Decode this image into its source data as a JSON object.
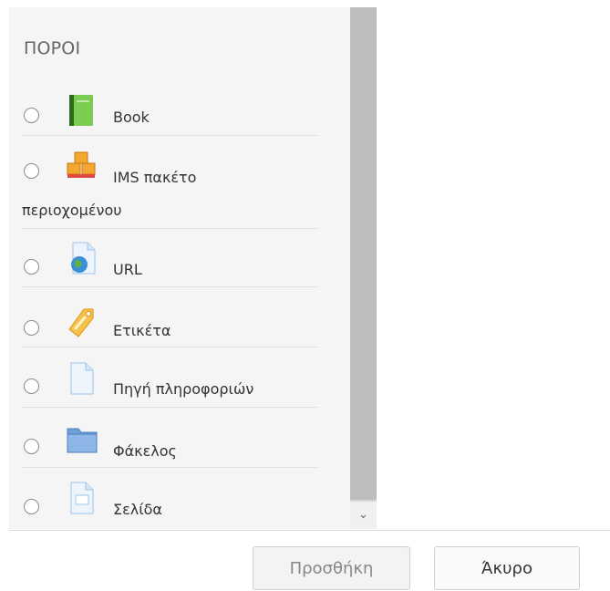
{
  "section": {
    "title": "ΠΟΡΟΙ"
  },
  "items": [
    {
      "label": "Book",
      "icon": "book-icon"
    },
    {
      "label": "IMS πακέτο",
      "label_line2": "περιοχομένου",
      "icon": "package-icon"
    },
    {
      "label": "URL",
      "icon": "url-icon"
    },
    {
      "label": "Ετικέτα",
      "icon": "label-tag-icon"
    },
    {
      "label": "Πηγή πληροφοριών",
      "icon": "file-icon"
    },
    {
      "label": "Φάκελος",
      "icon": "folder-icon"
    },
    {
      "label": "Σελίδα",
      "icon": "page-icon"
    }
  ],
  "scrollbar": {
    "arrow": "⌄"
  },
  "buttons": {
    "add": "Προσθήκη",
    "cancel": "Άκυρο"
  },
  "colors": {
    "panel_bg": "#f5f5f5",
    "book_green": "#6cc04a",
    "package_orange": "#f2a72e",
    "doc_blue": "#9cc4ea"
  }
}
